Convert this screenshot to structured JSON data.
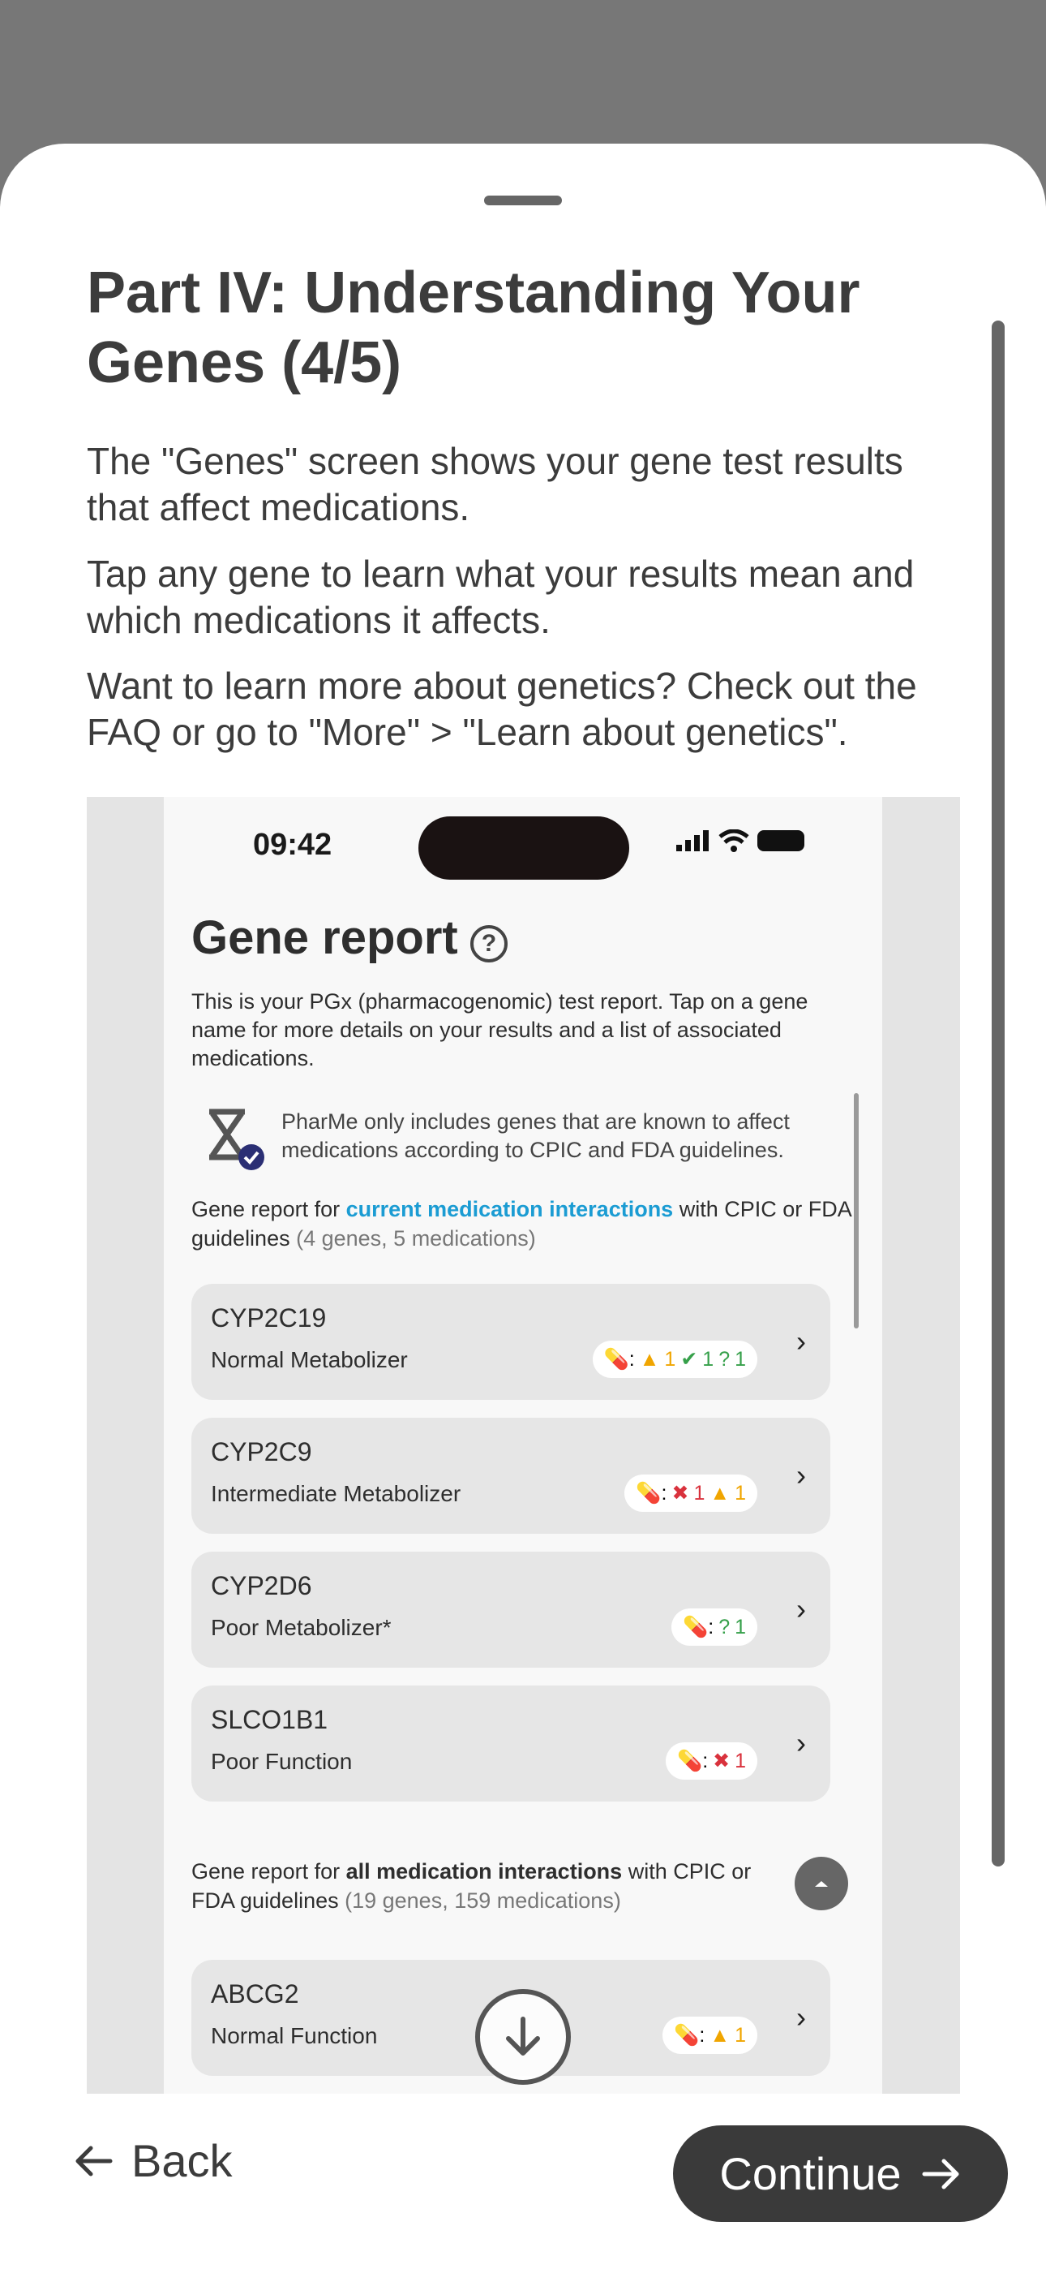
{
  "onboarding": {
    "title": "Part IV: Understanding Your Genes (4/5)",
    "paragraphs": [
      "The \"Genes\" screen shows your gene test results that affect medications.",
      "Tap any gene to learn what your results mean and which medications it affects.",
      "Want to learn more about genetics? Check out the FAQ or go to \"More\" > \"Learn about genetics\"."
    ],
    "back_label": "Back",
    "continue_label": "Continue"
  },
  "screenshot": {
    "time": "09:42",
    "title": "Gene report",
    "description": "This is your PGx (pharmacogenomic) test report. Tap on a gene name for more details on your results and a list of associated medications.",
    "note": "PharMe only includes genes that are known to affect medications according to CPIC and FDA guidelines.",
    "current_section": {
      "prefix": "Gene report for ",
      "link": "current medication interactions",
      "suffix": " with CPIC or FDA guidelines",
      "count": " (4 genes, 5 medications)"
    },
    "all_section": {
      "prefix": "Gene report for ",
      "bold": "all medication interactions",
      "suffix": " with CPIC or FDA guidelines",
      "count": " (19 genes, 159 medications)"
    },
    "genes": [
      {
        "name": "CYP2C19",
        "phenotype": "Normal Metabolizer",
        "counts": [
          {
            "type": "warn",
            "value": "1"
          },
          {
            "type": "ok",
            "value": "1"
          },
          {
            "type": "info",
            "value": "1"
          }
        ]
      },
      {
        "name": "CYP2C9",
        "phenotype": "Intermediate Metabolizer",
        "counts": [
          {
            "type": "bad",
            "value": "1"
          },
          {
            "type": "warn",
            "value": "1"
          }
        ]
      },
      {
        "name": "CYP2D6",
        "phenotype": "Poor Metabolizer*",
        "counts": [
          {
            "type": "info",
            "value": "1"
          }
        ]
      },
      {
        "name": "SLCO1B1",
        "phenotype": "Poor Function",
        "counts": [
          {
            "type": "bad",
            "value": "1"
          }
        ]
      },
      {
        "name": "ABCG2",
        "phenotype": "Normal Function",
        "counts": [
          {
            "type": "warn",
            "value": "1"
          }
        ]
      }
    ],
    "colors": {
      "ok": "#36a04a",
      "warn": "#f0a500",
      "bad": "#d9323d",
      "link": "#1b9cd3"
    }
  }
}
